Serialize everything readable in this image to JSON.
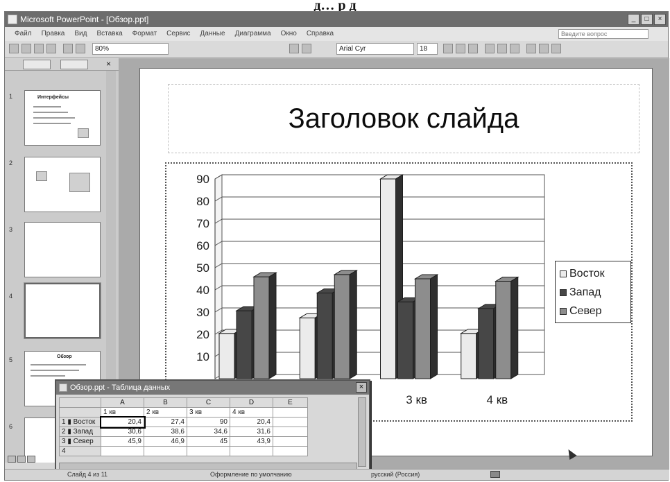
{
  "caption": "д…  р  д",
  "window": {
    "title": "Microsoft PowerPoint - [Обзор.ppt]",
    "buttons": [
      "_",
      "□",
      "×"
    ]
  },
  "menu": {
    "items": [
      "Файл",
      "Правка",
      "Вид",
      "Вставка",
      "Формат",
      "Сервис",
      "Данные",
      "Диаграмма",
      "Окно",
      "Справка"
    ],
    "ask_placeholder": "Введите вопрос"
  },
  "toolbar": {
    "zoom": "80%",
    "font": "Arial Cyr",
    "size": "18"
  },
  "thumbnails": [
    {
      "num": "1",
      "title": "Интерфейсы"
    },
    {
      "num": "2",
      "title": ""
    },
    {
      "num": "3",
      "title": ""
    },
    {
      "num": "4",
      "title": ""
    },
    {
      "num": "5",
      "title": "Обзор"
    },
    {
      "num": "6",
      "title": ""
    }
  ],
  "slide": {
    "title": "Заголовок слайда"
  },
  "chart_data": {
    "type": "bar",
    "categories": [
      "1 кв",
      "2 кв",
      "3 кв",
      "4 кв"
    ],
    "visible_category_labels": [
      "3 кв",
      "4 кв"
    ],
    "series": [
      {
        "name": "Восток",
        "values": [
          20.4,
          27.4,
          90,
          20.4
        ],
        "color": "#e6e6e6"
      },
      {
        "name": "Запад",
        "values": [
          30.6,
          38.6,
          34.6,
          31.6
        ],
        "color": "#4a4a4a"
      },
      {
        "name": "Север",
        "values": [
          45.9,
          46.9,
          45,
          43.9
        ],
        "color": "#8c8c8c"
      }
    ],
    "yticks": [
      "10",
      "20",
      "30",
      "40",
      "50",
      "60",
      "70",
      "80",
      "90"
    ],
    "ylim": [
      0,
      90
    ],
    "grid": true,
    "legend": "right"
  },
  "datasheet": {
    "title": "Обзор.ppt - Таблица данных",
    "columns": [
      "",
      "A",
      "B",
      "C",
      "D",
      "E"
    ],
    "header_row": [
      "",
      "1 кв",
      "2 кв",
      "3 кв",
      "4 кв",
      ""
    ],
    "rows": [
      {
        "num": "1",
        "name": "Восток",
        "values": [
          "20,4",
          "27,4",
          "90",
          "20,4",
          ""
        ]
      },
      {
        "num": "2",
        "name": "Запад",
        "values": [
          "30,6",
          "38,6",
          "34,6",
          "31,6",
          ""
        ]
      },
      {
        "num": "3",
        "name": "Север",
        "values": [
          "45,9",
          "46,9",
          "45",
          "43,9",
          ""
        ]
      },
      {
        "num": "4",
        "name": "",
        "values": [
          "",
          "",
          "",
          "",
          ""
        ]
      }
    ]
  },
  "status": {
    "slide": "Слайд 4 из 11",
    "design": "Оформление по умолчанию",
    "lang": "русский (Россия)"
  }
}
